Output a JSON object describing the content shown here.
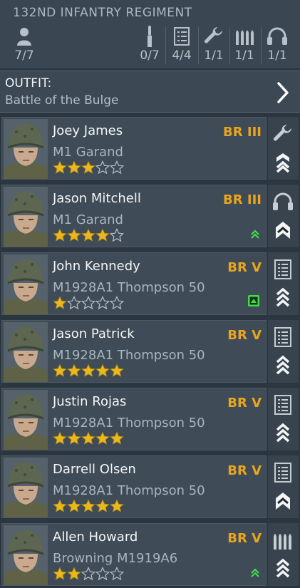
{
  "header": {
    "regiment": "132ND INFANTRY REGIMENT",
    "stats": [
      {
        "icon": "soldier-icon",
        "value": "7/7"
      },
      {
        "icon": "rifleman-icon",
        "value": "0/7"
      },
      {
        "icon": "radio-list-icon",
        "value": "4/4"
      },
      {
        "icon": "wrench-icon",
        "value": "1/1"
      },
      {
        "icon": "ammo-icon",
        "value": "1/1"
      },
      {
        "icon": "headphones-icon",
        "value": "1/1"
      }
    ]
  },
  "outfit": {
    "label": "OUTFIT:",
    "name": "Battle of the Bulge"
  },
  "soldiers": [
    {
      "name": "Joey James",
      "weapon": "M1 Garand",
      "br": "BR III",
      "stars": 3,
      "role": "wrench-icon",
      "rank": "sergeant",
      "badge": ""
    },
    {
      "name": "Jason Mitchell",
      "weapon": "M1 Garand",
      "br": "BR III",
      "stars": 4,
      "role": "headphones-icon",
      "rank": "corporal",
      "badge": "upgrade-chevrons"
    },
    {
      "name": "John Kennedy",
      "weapon": "M1928A1 Thompson 50",
      "br": "BR V",
      "stars": 1,
      "role": "radio-list-icon",
      "rank": "sergeant-3",
      "badge": "upgrade-box"
    },
    {
      "name": "Jason Patrick",
      "weapon": "M1928A1 Thompson 50",
      "br": "BR V",
      "stars": 5,
      "role": "radio-list-icon",
      "rank": "sergeant-3",
      "badge": ""
    },
    {
      "name": "Justin Rojas",
      "weapon": "M1928A1 Thompson 50",
      "br": "BR V",
      "stars": 5,
      "role": "radio-list-icon",
      "rank": "sergeant-3",
      "badge": ""
    },
    {
      "name": "Darrell Olsen",
      "weapon": "M1928A1 Thompson 50",
      "br": "BR V",
      "stars": 5,
      "role": "radio-list-icon",
      "rank": "corporal",
      "badge": ""
    },
    {
      "name": "Allen Howard",
      "weapon": "Browning M1919A6",
      "br": "BR V",
      "stars": 2,
      "role": "ammo-icon",
      "rank": "sergeant-3",
      "badge": "upgrade-chevrons"
    }
  ],
  "colors": {
    "accent": "#e8a51f",
    "star": "#e8b81c",
    "upgrade": "#3fdc4a"
  }
}
